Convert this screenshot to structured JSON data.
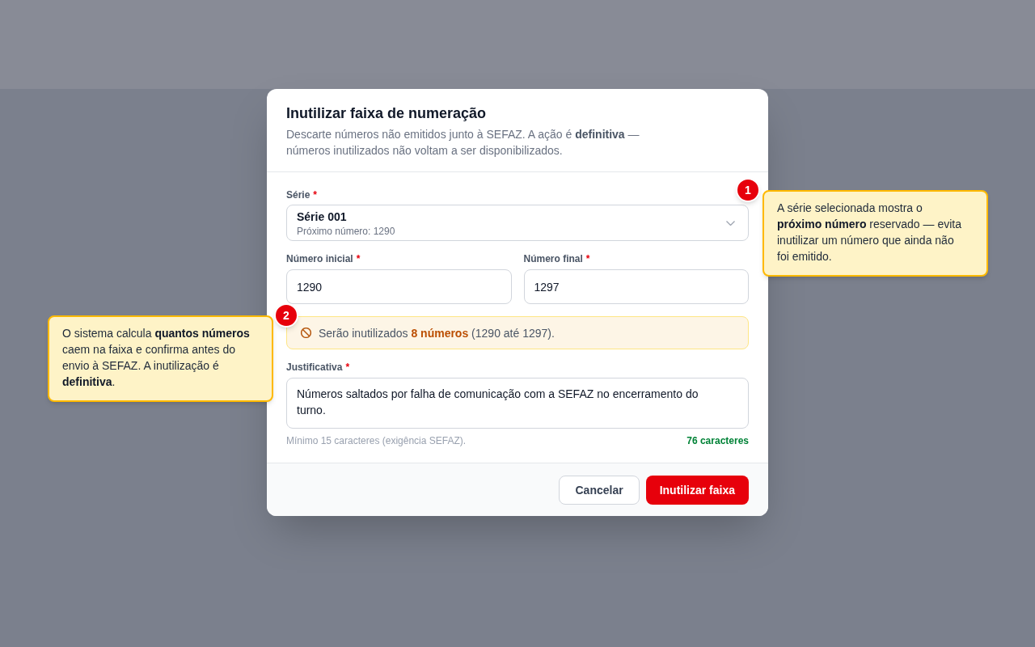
{
  "dialog": {
    "title": "Inutilizar faixa de numeração",
    "description": "Descarte números não emitidos junto à SEFAZ. A ação é **definitiva** — números inutilizados não voltam a ser disponibilizados."
  },
  "series_field": {
    "label": "Série",
    "required_mark": "*",
    "value": "Série 001",
    "hint": "Próximo número: 1290"
  },
  "range_fields": [
    {
      "label": "Número inicial",
      "required_mark": "*",
      "value": "1290"
    },
    {
      "label": "Número final",
      "required_mark": "*",
      "value": "1297"
    }
  ],
  "summary": {
    "text": "Serão inutilizados **8 números** (1290 até 1297)."
  },
  "justification": {
    "label": "Justificativa",
    "required_mark": "*",
    "value": "Números saltados por falha de comunicação com a SEFAZ no encerramento do turno.",
    "hint": "Mínimo 15 caracteres (exigência SEFAZ).",
    "count": "76 caracteres"
  },
  "buttons": [
    {
      "label": "Cancelar",
      "kind": "secondary"
    },
    {
      "label": "Inutilizar faixa",
      "kind": "primary"
    }
  ],
  "callouts": [
    {
      "number": "1",
      "text": "A série selecionada mostra o **próximo número** reservado — evita inutilizar um número que ainda não foi emitido."
    },
    {
      "number": "2",
      "text": "O sistema calcula **quantos números** caem na faixa e confirma antes do envio à SEFAZ. A inutilização é **definitiva**."
    }
  ]
}
